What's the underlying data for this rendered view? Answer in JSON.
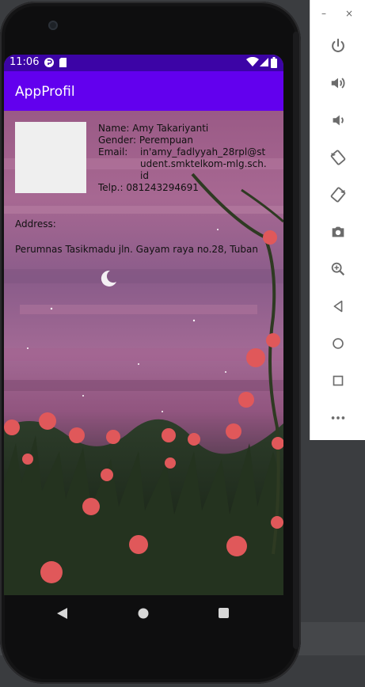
{
  "status_bar": {
    "time": "11:06"
  },
  "app_bar": {
    "title": "AppProfil"
  },
  "profile": {
    "name_label": "Name:",
    "name_value": "Amy  Takariyanti",
    "gender_label": "Gender:",
    "gender_value": "Perempuan",
    "email_label": "Email:",
    "email_value": "in'amy_fadlyyah_28rpl@student.smktelkom-mlg.sch.id",
    "phone_label": "Telp.:",
    "phone_value": "081243294691",
    "address_label": "Address:",
    "address_value": "Perumnas Tasikmadu jln. Gayam raya no.28, Tuban"
  },
  "emulator_panel": {
    "tools": [
      "power-icon",
      "volume-up-icon",
      "volume-down-icon",
      "rotate-left-icon",
      "rotate-right-icon",
      "camera-icon",
      "zoom-icon",
      "back-icon",
      "home-icon",
      "overview-icon",
      "more-icon"
    ],
    "minimize_label": "–",
    "close_label": "×"
  },
  "colors": {
    "status_bar": "#3c04a6",
    "app_bar": "#6200ee"
  }
}
